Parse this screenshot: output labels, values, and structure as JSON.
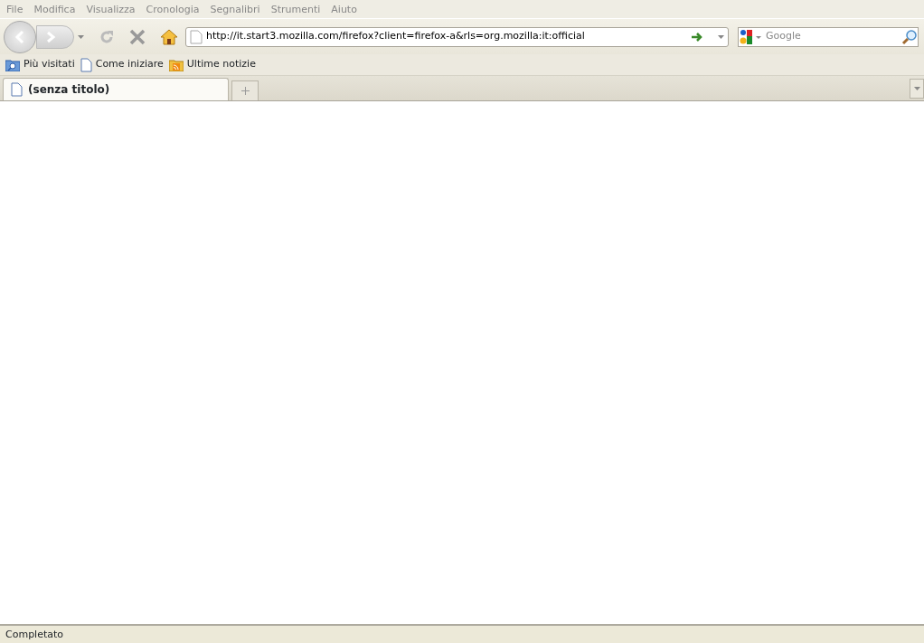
{
  "menu": [
    {
      "label": "File"
    },
    {
      "label": "Modifica"
    },
    {
      "label": "Visualizza"
    },
    {
      "label": "Cronologia"
    },
    {
      "label": "Segnalibri"
    },
    {
      "label": "Strumenti"
    },
    {
      "label": "Aiuto"
    }
  ],
  "address": {
    "value": "http://it.start3.mozilla.com/firefox?client=firefox-a&rls=org.mozilla:it:official"
  },
  "search": {
    "placeholder": "Google"
  },
  "bookmarks": [
    {
      "label": "Più visitati",
      "kind": "smart"
    },
    {
      "label": "Come iniziare",
      "kind": "page"
    },
    {
      "label": "Ultime notizie",
      "kind": "feed"
    }
  ],
  "tabs": [
    {
      "label": "(senza titolo)",
      "selected": true
    }
  ],
  "status_bar": "Completato"
}
